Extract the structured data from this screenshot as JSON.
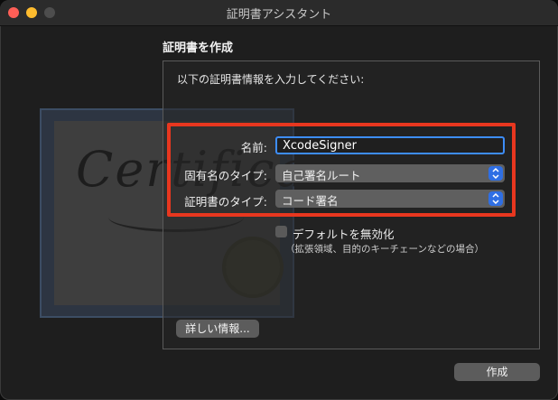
{
  "window": {
    "title": "証明書アシスタント"
  },
  "section": {
    "title": "証明書を作成"
  },
  "panel": {
    "instruction": "以下の証明書情報を入力してください:"
  },
  "form": {
    "name_label": "名前:",
    "name_value": "XcodeSigner",
    "identity_type_label": "固有名のタイプ:",
    "identity_type_value": "自己署名ルート",
    "certificate_type_label": "証明書のタイプ:",
    "certificate_type_value": "コード署名"
  },
  "override": {
    "label": "デフォルトを無効化",
    "sublabel": "（拡張領域、目的のキーチェーンなどの場合）",
    "checked": false
  },
  "buttons": {
    "more_info": "詳しい情報...",
    "create": "作成"
  },
  "background_image": {
    "word": "Certificate"
  },
  "colors": {
    "highlight": "#e8371f",
    "accent": "#2f6fe4",
    "focus_ring": "#3d8dfb"
  }
}
